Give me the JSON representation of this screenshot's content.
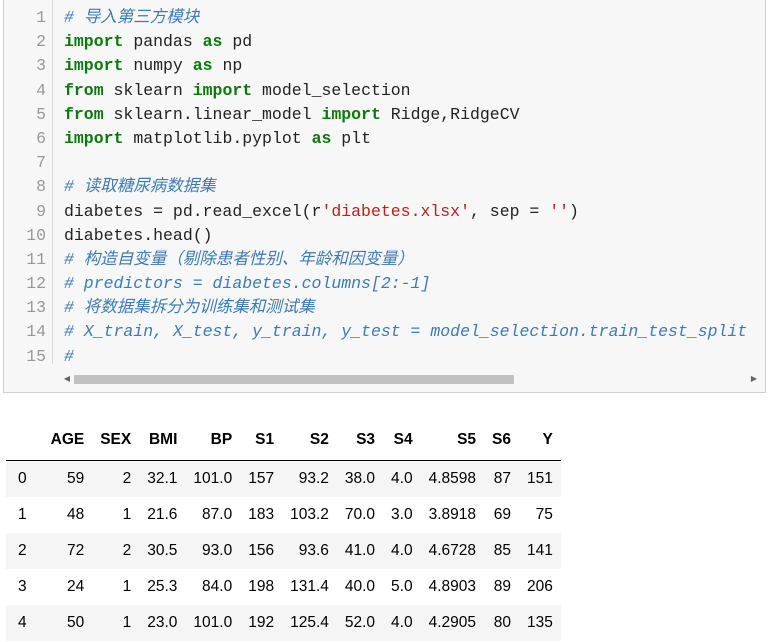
{
  "code": {
    "lines": [
      {
        "n": "1",
        "parts": [
          {
            "t": "# 导入第三方模块",
            "c": "cm"
          }
        ]
      },
      {
        "n": "2",
        "parts": [
          {
            "t": "import",
            "c": "kw"
          },
          {
            "t": " pandas ",
            "c": ""
          },
          {
            "t": "as",
            "c": "kw"
          },
          {
            "t": " pd",
            "c": ""
          }
        ]
      },
      {
        "n": "3",
        "parts": [
          {
            "t": "import",
            "c": "kw"
          },
          {
            "t": " numpy ",
            "c": ""
          },
          {
            "t": "as",
            "c": "kw"
          },
          {
            "t": " np",
            "c": ""
          }
        ]
      },
      {
        "n": "4",
        "parts": [
          {
            "t": "from",
            "c": "kw"
          },
          {
            "t": " sklearn ",
            "c": ""
          },
          {
            "t": "import",
            "c": "kw"
          },
          {
            "t": " model_selection",
            "c": ""
          }
        ]
      },
      {
        "n": "5",
        "parts": [
          {
            "t": "from",
            "c": "kw"
          },
          {
            "t": " sklearn.linear_model ",
            "c": ""
          },
          {
            "t": "import",
            "c": "kw"
          },
          {
            "t": " Ridge,RidgeCV",
            "c": ""
          }
        ]
      },
      {
        "n": "6",
        "parts": [
          {
            "t": "import",
            "c": "kw"
          },
          {
            "t": " matplotlib.pyplot ",
            "c": ""
          },
          {
            "t": "as",
            "c": "kw"
          },
          {
            "t": " plt",
            "c": ""
          }
        ]
      },
      {
        "n": "7",
        "parts": []
      },
      {
        "n": "8",
        "parts": [
          {
            "t": "# 读取糖尿病数据集",
            "c": "cm"
          }
        ]
      },
      {
        "n": "9",
        "parts": [
          {
            "t": "diabetes = pd.read_excel(r",
            "c": ""
          },
          {
            "t": "'diabetes.xlsx'",
            "c": "st"
          },
          {
            "t": ", sep = ",
            "c": ""
          },
          {
            "t": "''",
            "c": "st"
          },
          {
            "t": ")",
            "c": ""
          }
        ]
      },
      {
        "n": "10",
        "parts": [
          {
            "t": "diabetes.head()",
            "c": ""
          }
        ]
      },
      {
        "n": "11",
        "parts": [
          {
            "t": "# 构造自变量（剔除患者性别、年龄和因变量）",
            "c": "cm"
          }
        ]
      },
      {
        "n": "12",
        "parts": [
          {
            "t": "# predictors = diabetes.columns[2:-1]",
            "c": "cm"
          }
        ]
      },
      {
        "n": "13",
        "parts": [
          {
            "t": "# 将数据集拆分为训练集和测试集",
            "c": "cm"
          }
        ]
      },
      {
        "n": "14",
        "parts": [
          {
            "t": "# X_train, X_test, y_train, y_test = model_selection.train_test_split",
            "c": "cm"
          }
        ]
      },
      {
        "n": "15",
        "parts": [
          {
            "t": "#",
            "c": "cm"
          }
        ]
      }
    ]
  },
  "scrollbar": {
    "left_arrow": "◀",
    "right_arrow": "▶"
  },
  "table": {
    "columns": [
      "",
      "AGE",
      "SEX",
      "BMI",
      "BP",
      "S1",
      "S2",
      "S3",
      "S4",
      "S5",
      "S6",
      "Y"
    ],
    "rows": [
      [
        "0",
        "59",
        "2",
        "32.1",
        "101.0",
        "157",
        "93.2",
        "38.0",
        "4.0",
        "4.8598",
        "87",
        "151"
      ],
      [
        "1",
        "48",
        "1",
        "21.6",
        "87.0",
        "183",
        "103.2",
        "70.0",
        "3.0",
        "3.8918",
        "69",
        "75"
      ],
      [
        "2",
        "72",
        "2",
        "30.5",
        "93.0",
        "156",
        "93.6",
        "41.0",
        "4.0",
        "4.6728",
        "85",
        "141"
      ],
      [
        "3",
        "24",
        "1",
        "25.3",
        "84.0",
        "198",
        "131.4",
        "40.0",
        "5.0",
        "4.8903",
        "89",
        "206"
      ],
      [
        "4",
        "50",
        "1",
        "23.0",
        "101.0",
        "192",
        "125.4",
        "52.0",
        "4.0",
        "4.2905",
        "80",
        "135"
      ]
    ]
  }
}
